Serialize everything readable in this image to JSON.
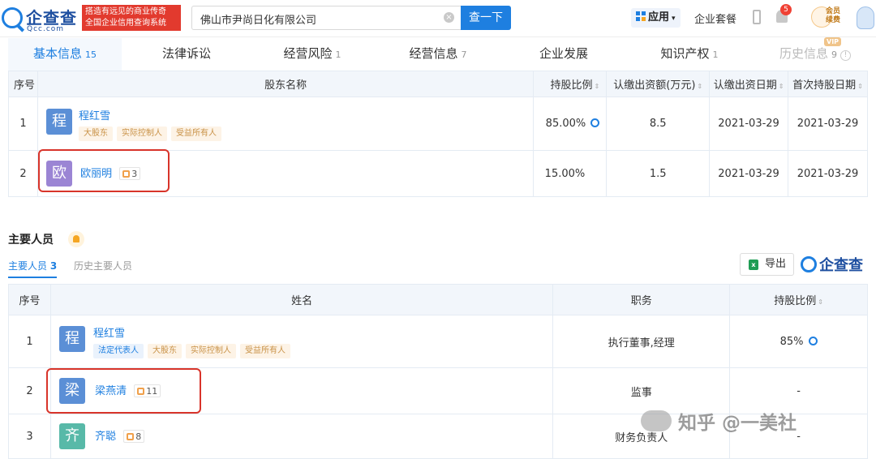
{
  "header": {
    "logo_text": "企查查",
    "logo_sub": "Qcc.com",
    "slogan_line1": "搭造有远见的商业传奇",
    "slogan_line2": "全国企业信用查询系统",
    "search_value": "佛山市尹尚日化有限公司",
    "search_button": "查一下",
    "apps_label": "应用",
    "package_label": "企业套餐",
    "notification_count": "5",
    "member_label_1": "会员",
    "member_label_2": "续费"
  },
  "tabs": [
    {
      "label": "基本信息",
      "count": "15"
    },
    {
      "label": "法律诉讼",
      "count": ""
    },
    {
      "label": "经营风险",
      "count": "1"
    },
    {
      "label": "经营信息",
      "count": "7"
    },
    {
      "label": "企业发展",
      "count": ""
    },
    {
      "label": "知识产权",
      "count": "1"
    },
    {
      "label": "历史信息",
      "count": "9"
    }
  ],
  "vip_badge": "VIP",
  "shareholders": {
    "headers": {
      "no": "序号",
      "name": "股东名称",
      "ratio": "持股比例",
      "amount": "认缴出资额(万元)",
      "date": "认缴出资日期",
      "first_date": "首次持股日期"
    },
    "rows": [
      {
        "no": "1",
        "avatar": "程",
        "name": "程红雪",
        "tags": [
          "大股东",
          "实际控制人",
          "受益所有人"
        ],
        "relations": "",
        "ratio": "85.00%",
        "amount": "8.5",
        "date": "2021-03-29",
        "first_date": "2021-03-29"
      },
      {
        "no": "2",
        "avatar": "欧",
        "name": "欧丽明",
        "tags": [],
        "relations": "3",
        "ratio": "15.00%",
        "amount": "1.5",
        "date": "2021-03-29",
        "first_date": "2021-03-29"
      }
    ]
  },
  "personnel": {
    "title": "主要人员",
    "subtab_active": "主要人员",
    "subtab_active_count": "3",
    "subtab_history": "历史主要人员",
    "export_label": "导出",
    "brand_text": "企查查",
    "headers": {
      "no": "序号",
      "name": "姓名",
      "role": "职务",
      "ratio": "持股比例"
    },
    "rows": [
      {
        "no": "1",
        "avatar": "程",
        "name": "程红雪",
        "tags": [
          "法定代表人",
          "大股东",
          "实际控制人",
          "受益所有人"
        ],
        "relations": "",
        "role": "执行董事,经理",
        "ratio": "85%"
      },
      {
        "no": "2",
        "avatar": "梁",
        "name": "梁燕清",
        "tags": [],
        "relations": "11",
        "role": "监事",
        "ratio": "-"
      },
      {
        "no": "3",
        "avatar": "齐",
        "name": "齐聪",
        "tags": [],
        "relations": "8",
        "role": "财务负责人",
        "ratio": "-"
      }
    ]
  },
  "watermark": "知乎 @一美社",
  "colors": {
    "accent": "#1e7fe0",
    "highlight_box": "#d8342a",
    "avatar_cheng": "#5b8fd6",
    "avatar_ou": "#9b85d4",
    "avatar_liang": "#5b8fd6",
    "avatar_qi": "#58b9a8"
  }
}
